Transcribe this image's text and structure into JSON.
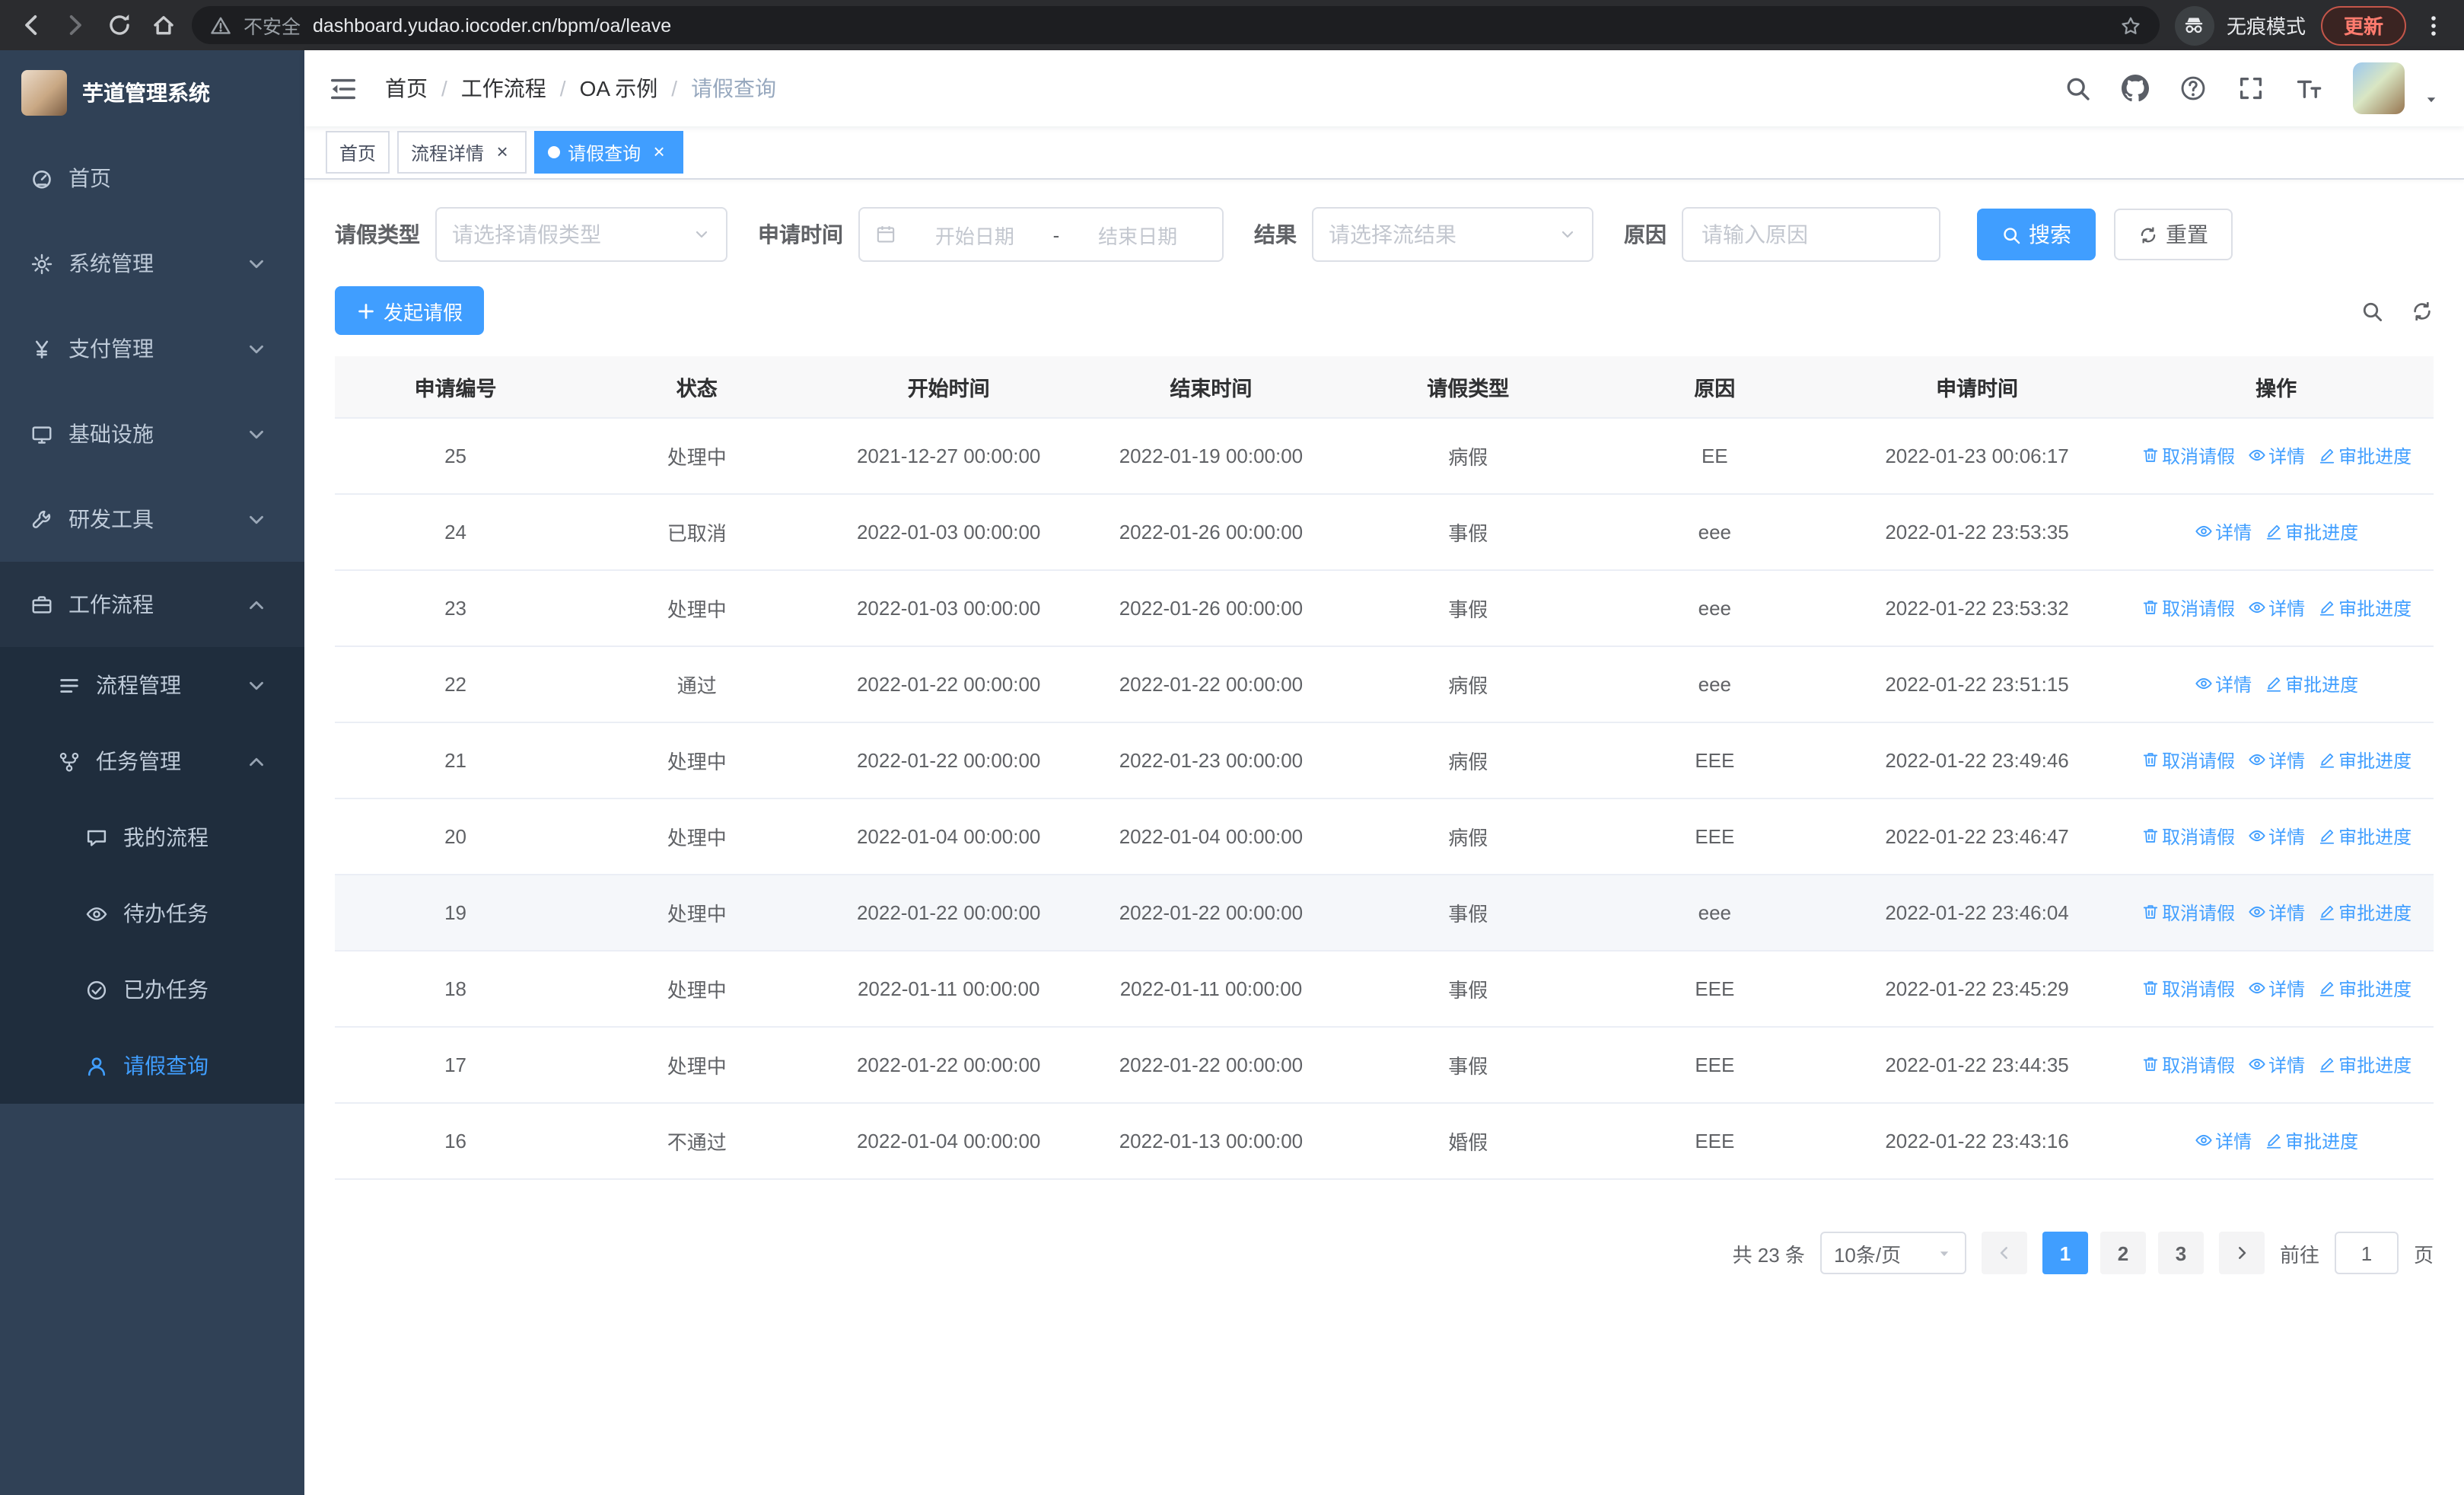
{
  "browser": {
    "nav_icons": [
      "back-icon",
      "forward-icon",
      "reload-icon",
      "home-icon"
    ],
    "security_icon": "warning-icon",
    "security_label": "不安全",
    "url": "dashboard.yudao.iocoder.cn/bpm/oa/leave",
    "bookmark_icon": "star-icon",
    "incognito_icon": "incognito-icon",
    "incognito_label": "无痕模式",
    "update_label": "更新",
    "menu_icon": "dots-vertical-icon"
  },
  "sidebar": {
    "title": "芋道管理系统",
    "menu": [
      {
        "key": "home",
        "label": "首页",
        "icon": "dashboard-icon"
      },
      {
        "key": "system",
        "label": "系统管理",
        "icon": "gear-icon",
        "has_children": true
      },
      {
        "key": "payment",
        "label": "支付管理",
        "icon": "yen-icon",
        "has_children": true
      },
      {
        "key": "infrastructure",
        "label": "基础设施",
        "icon": "monitor-icon",
        "has_children": true
      },
      {
        "key": "dev-tools",
        "label": "研发工具",
        "icon": "wrench-icon",
        "has_children": true
      },
      {
        "key": "workflow",
        "label": "工作流程",
        "icon": "briefcase-icon",
        "has_children": true,
        "expanded": true,
        "children": [
          {
            "key": "process-management",
            "label": "流程管理",
            "icon": "list-icon",
            "has_children": true
          },
          {
            "key": "task-management",
            "label": "任务管理",
            "icon": "fork-icon",
            "has_children": true,
            "expanded": true,
            "children": [
              {
                "key": "my-process",
                "label": "我的流程",
                "icon": "chat-icon"
              },
              {
                "key": "todo-tasks",
                "label": "待办任务",
                "icon": "eye-icon"
              },
              {
                "key": "done-tasks",
                "label": "已办任务",
                "icon": "check-circle-icon"
              },
              {
                "key": "leave-query",
                "label": "请假查询",
                "icon": "user-icon",
                "active": true
              }
            ]
          }
        ]
      }
    ]
  },
  "header": {
    "menu_toggle_icon": "hamburger-icon",
    "breadcrumb": [
      "首页",
      "工作流程",
      "OA 示例",
      "请假查询"
    ],
    "right_icons": [
      "search-icon",
      "github-icon",
      "question-icon",
      "fullscreen-icon",
      "font-size-icon"
    ],
    "avatar_caret_icon": "caret-down-icon"
  },
  "tabs": [
    {
      "key": "home",
      "label": "首页"
    },
    {
      "key": "process-detail",
      "label": "流程详情",
      "closable": true
    },
    {
      "key": "leave-query",
      "label": "请假查询",
      "closable": true,
      "active": true
    }
  ],
  "filters": {
    "leave_type_label": "请假类型",
    "leave_type_placeholder": "请选择请假类型",
    "apply_time_label": "申请时间",
    "start_date_placeholder": "开始日期",
    "date_separator": "-",
    "end_date_placeholder": "结束日期",
    "result_label": "结果",
    "result_placeholder": "请选择流结果",
    "reason_label": "原因",
    "reason_placeholder": "请输入原因",
    "search_button": "搜索",
    "reset_button": "重置",
    "calendar_icon": "calendar-icon",
    "search_icon": "search-icon",
    "reset_icon": "refresh-icon"
  },
  "toolbar": {
    "create_button": "发起请假",
    "create_icon": "plus-icon",
    "right_icons": [
      "search-icon",
      "refresh-icon"
    ]
  },
  "table": {
    "columns": [
      "申请编号",
      "状态",
      "开始时间",
      "结束时间",
      "请假类型",
      "原因",
      "申请时间",
      "操作"
    ],
    "action_defs": {
      "cancel": {
        "label": "取消请假",
        "icon": "trash-icon"
      },
      "detail": {
        "label": "详情",
        "icon": "view-icon"
      },
      "progress": {
        "label": "审批进度",
        "icon": "edit-icon"
      }
    },
    "hover_row_id": "19",
    "rows": [
      {
        "id": "25",
        "status": "处理中",
        "start": "2021-12-27 00:00:00",
        "end": "2022-01-19 00:00:00",
        "type": "病假",
        "reason": "EE",
        "applied": "2022-01-23 00:06:17",
        "actions": [
          "cancel",
          "detail",
          "progress"
        ]
      },
      {
        "id": "24",
        "status": "已取消",
        "start": "2022-01-03 00:00:00",
        "end": "2022-01-26 00:00:00",
        "type": "事假",
        "reason": "eee",
        "applied": "2022-01-22 23:53:35",
        "actions": [
          "detail",
          "progress"
        ]
      },
      {
        "id": "23",
        "status": "处理中",
        "start": "2022-01-03 00:00:00",
        "end": "2022-01-26 00:00:00",
        "type": "事假",
        "reason": "eee",
        "applied": "2022-01-22 23:53:32",
        "actions": [
          "cancel",
          "detail",
          "progress"
        ]
      },
      {
        "id": "22",
        "status": "通过",
        "start": "2022-01-22 00:00:00",
        "end": "2022-01-22 00:00:00",
        "type": "病假",
        "reason": "eee",
        "applied": "2022-01-22 23:51:15",
        "actions": [
          "detail",
          "progress"
        ]
      },
      {
        "id": "21",
        "status": "处理中",
        "start": "2022-01-22 00:00:00",
        "end": "2022-01-23 00:00:00",
        "type": "病假",
        "reason": "EEE",
        "applied": "2022-01-22 23:49:46",
        "actions": [
          "cancel",
          "detail",
          "progress"
        ]
      },
      {
        "id": "20",
        "status": "处理中",
        "start": "2022-01-04 00:00:00",
        "end": "2022-01-04 00:00:00",
        "type": "病假",
        "reason": "EEE",
        "applied": "2022-01-22 23:46:47",
        "actions": [
          "cancel",
          "detail",
          "progress"
        ]
      },
      {
        "id": "19",
        "status": "处理中",
        "start": "2022-01-22 00:00:00",
        "end": "2022-01-22 00:00:00",
        "type": "事假",
        "reason": "eee",
        "applied": "2022-01-22 23:46:04",
        "actions": [
          "cancel",
          "detail",
          "progress"
        ]
      },
      {
        "id": "18",
        "status": "处理中",
        "start": "2022-01-11 00:00:00",
        "end": "2022-01-11 00:00:00",
        "type": "事假",
        "reason": "EEE",
        "applied": "2022-01-22 23:45:29",
        "actions": [
          "cancel",
          "detail",
          "progress"
        ]
      },
      {
        "id": "17",
        "status": "处理中",
        "start": "2022-01-22 00:00:00",
        "end": "2022-01-22 00:00:00",
        "type": "事假",
        "reason": "EEE",
        "applied": "2022-01-22 23:44:35",
        "actions": [
          "cancel",
          "detail",
          "progress"
        ]
      },
      {
        "id": "16",
        "status": "不通过",
        "start": "2022-01-04 00:00:00",
        "end": "2022-01-13 00:00:00",
        "type": "婚假",
        "reason": "EEE",
        "applied": "2022-01-22 23:43:16",
        "actions": [
          "detail",
          "progress"
        ]
      }
    ]
  },
  "pagination": {
    "total_text": "共 23 条",
    "page_size": "10条/页",
    "pages": [
      "1",
      "2",
      "3"
    ],
    "active_page": "1",
    "prev_icon": "chevron-left-icon",
    "next_icon": "chevron-right-icon",
    "goto_prefix": "前往",
    "goto_value": "1",
    "goto_suffix": "页"
  }
}
